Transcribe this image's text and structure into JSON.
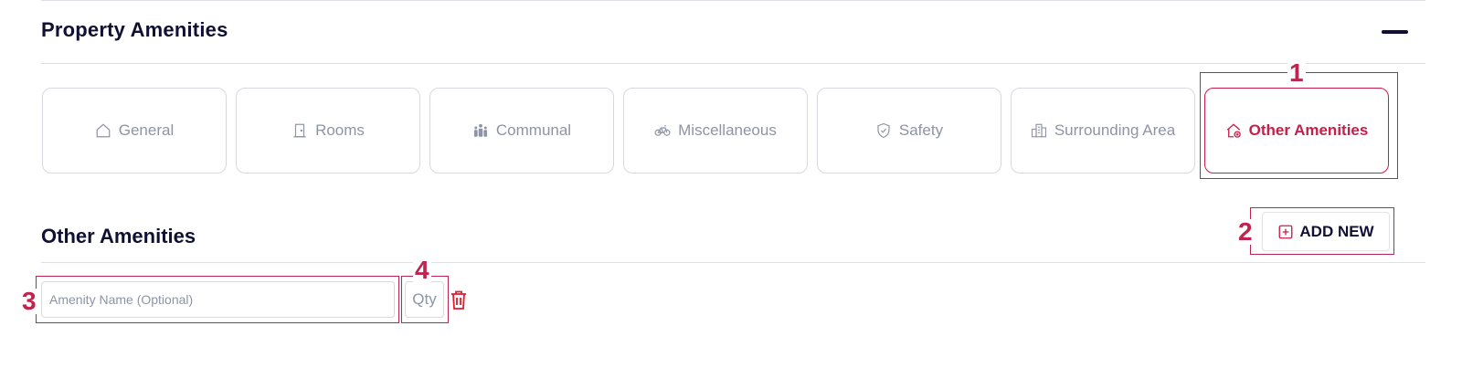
{
  "section": {
    "title": "Property Amenities",
    "collapse_icon": "minus-icon"
  },
  "tabs": [
    {
      "label": "General",
      "icon": "home-icon",
      "active": false
    },
    {
      "label": "Rooms",
      "icon": "door-icon",
      "active": false
    },
    {
      "label": "Communal",
      "icon": "people-icon",
      "active": false
    },
    {
      "label": "Miscellaneous",
      "icon": "bike-icon",
      "active": false
    },
    {
      "label": "Safety",
      "icon": "shield-icon",
      "active": false
    },
    {
      "label": "Surrounding Area",
      "icon": "buildings-icon",
      "active": false
    },
    {
      "label": "Other Amenities",
      "icon": "home-plus-icon",
      "active": true
    }
  ],
  "subsection": {
    "title": "Other Amenities"
  },
  "add_button": {
    "label": "ADD NEW",
    "icon": "plus-square-icon"
  },
  "amenity_row": {
    "name_placeholder": "Amenity Name (Optional)",
    "qty_placeholder": "Qty",
    "delete_icon": "trash-icon"
  },
  "annotations": [
    "1",
    "2",
    "3",
    "4"
  ],
  "colors": {
    "accent": "#c81e4a",
    "heading": "#0f1033",
    "muted": "#8d94a5",
    "border": "#d6d9de",
    "annotation": "#c0244c"
  }
}
